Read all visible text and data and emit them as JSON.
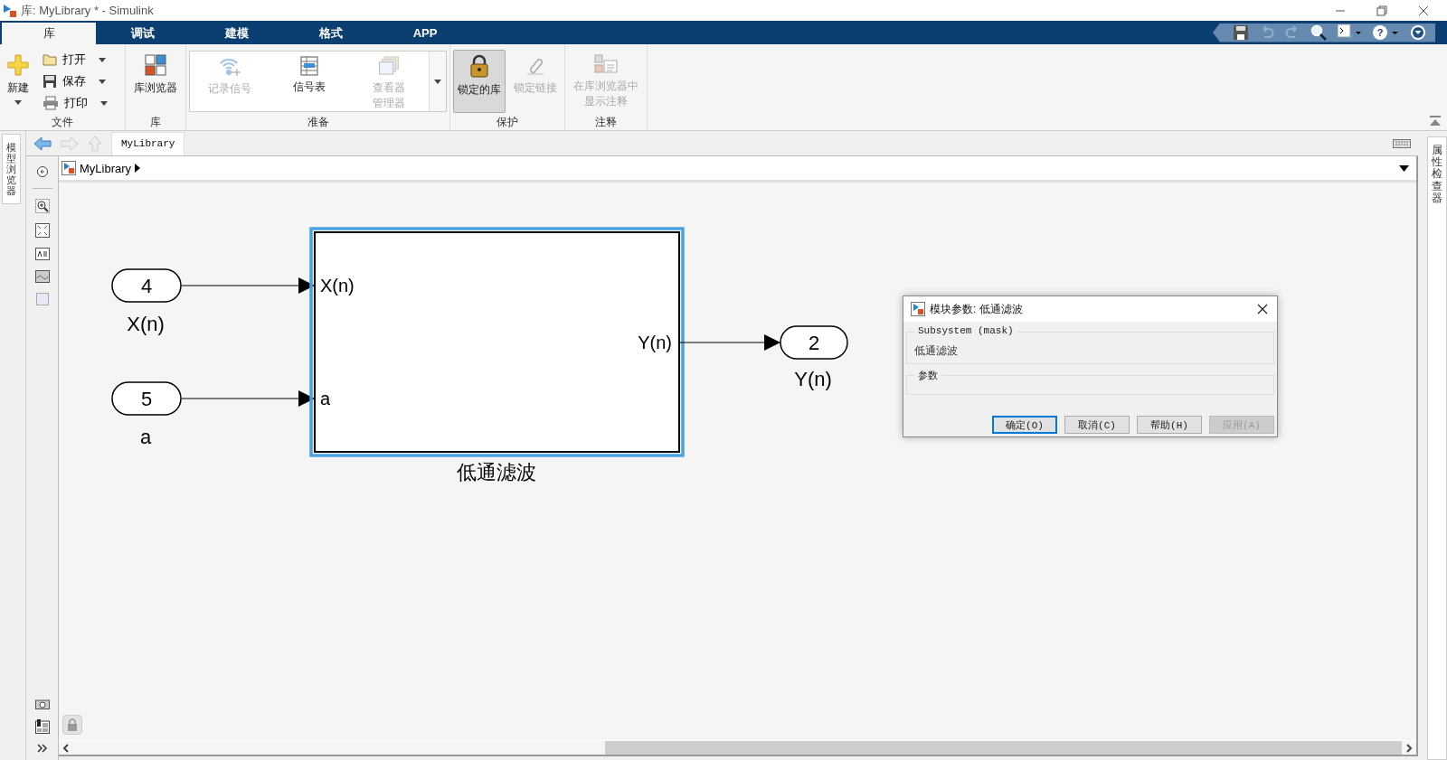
{
  "window": {
    "title": "库: MyLibrary * - Simulink"
  },
  "tabs": [
    {
      "label": "库",
      "selected": true
    },
    {
      "label": "调试",
      "selected": false
    },
    {
      "label": "建模",
      "selected": false
    },
    {
      "label": "格式",
      "selected": false
    },
    {
      "label": "APP",
      "selected": false
    }
  ],
  "ribbon": {
    "file": {
      "label": "文件",
      "new": "新建",
      "open": "打开",
      "save": "保存",
      "print": "打印"
    },
    "library": {
      "label": "库",
      "browser": "库浏览器"
    },
    "prepare": {
      "label": "准备",
      "items": [
        {
          "label": "记录信号",
          "disabled": true
        },
        {
          "label": "信号表",
          "disabled": false
        },
        {
          "label": "查看器管理器",
          "disabled": true
        }
      ]
    },
    "protect": {
      "label": "保护",
      "items": [
        {
          "label": "锁定的库",
          "selected": true,
          "disabled": false
        },
        {
          "label": "锁定链接",
          "selected": false,
          "disabled": true
        }
      ]
    },
    "annotate": {
      "label": "注释",
      "items": [
        {
          "label": "在库浏览器中显示注释",
          "disabled": true
        }
      ]
    }
  },
  "quick_access": {
    "help": "?"
  },
  "left_panel": {
    "label": "模型浏览器"
  },
  "right_panel": {
    "label": "属性检查器"
  },
  "editor_tab": {
    "label": "MyLibrary"
  },
  "breadcrumb": {
    "label": "MyLibrary"
  },
  "diagram": {
    "inports": [
      {
        "number": "4",
        "name": "X(n)"
      },
      {
        "number": "5",
        "name": "a"
      }
    ],
    "subsystem": {
      "name": "低通滤波",
      "selected": true,
      "inputs": [
        "X(n)",
        "a"
      ],
      "outputs": [
        "Y(n)"
      ]
    },
    "outports": [
      {
        "number": "2",
        "name": "Y(n)"
      }
    ]
  },
  "dialog": {
    "title": "模块参数: 低通滤波",
    "section_1": {
      "label": "Subsystem (mask)",
      "text": "低通滤波"
    },
    "section_2": {
      "label": "参数"
    },
    "buttons": [
      {
        "label": "确定(O)",
        "focused": true,
        "disabled": false
      },
      {
        "label": "取消(C)",
        "focused": false,
        "disabled": false
      },
      {
        "label": "帮助(H)",
        "focused": false,
        "disabled": false
      },
      {
        "label": "应用(A)",
        "focused": false,
        "disabled": true
      }
    ]
  }
}
